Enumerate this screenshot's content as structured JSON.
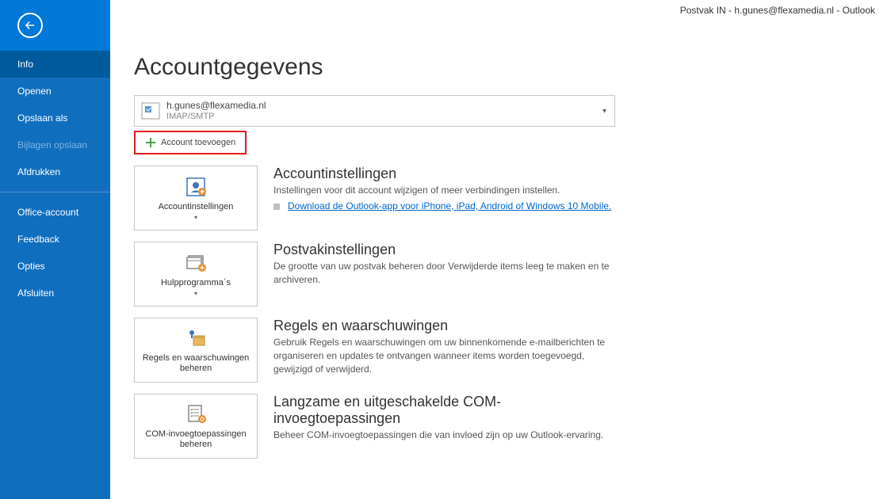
{
  "titlebar": "Postvak IN - h.gunes@flexamedia.nl  -  Outlook",
  "sidebar": {
    "items": [
      {
        "label": "Info",
        "active": true
      },
      {
        "label": "Openen"
      },
      {
        "label": "Opslaan als"
      },
      {
        "label": "Bijlagen opslaan",
        "disabled": true
      },
      {
        "label": "Afdrukken"
      },
      {
        "divider": true
      },
      {
        "label": "Office-account"
      },
      {
        "label": "Feedback"
      },
      {
        "label": "Opties"
      },
      {
        "label": "Afsluiten"
      }
    ]
  },
  "page": {
    "title": "Accountgegevens"
  },
  "account": {
    "email": "h.gunes@flexamedia.nl",
    "type": "IMAP/SMTP"
  },
  "add_account": {
    "label": "Account toevoegen"
  },
  "sections": [
    {
      "tile_label": "Accountinstellingen",
      "tile_has_dropdown": true,
      "title": "Accountinstellingen",
      "desc": "Instellingen voor dit account wijzigen of meer verbindingen instellen.",
      "link": "Download de Outlook-app voor iPhone, iPad, Android of Windows 10 Mobile."
    },
    {
      "tile_label": "Hulpprogramma´s",
      "tile_has_dropdown": true,
      "title": "Postvakinstellingen",
      "desc": "De grootte van uw postvak beheren door Verwijderde items leeg te maken en te archiveren."
    },
    {
      "tile_label": "Regels en waarschuwingen beheren",
      "title": "Regels en waarschuwingen",
      "desc": "Gebruik Regels en waarschuwingen om uw binnenkomende e-mailberichten te organiseren en updates te ontvangen wanneer items worden toegevoegd, gewijzigd of verwijderd."
    },
    {
      "tile_label": "COM-invoegtoepassingen beheren",
      "title": "Langzame en uitgeschakelde COM-invoegtoepassingen",
      "desc": "Beheer COM-invoegtoepassingen die van invloed zijn op uw Outlook-ervaring."
    }
  ]
}
